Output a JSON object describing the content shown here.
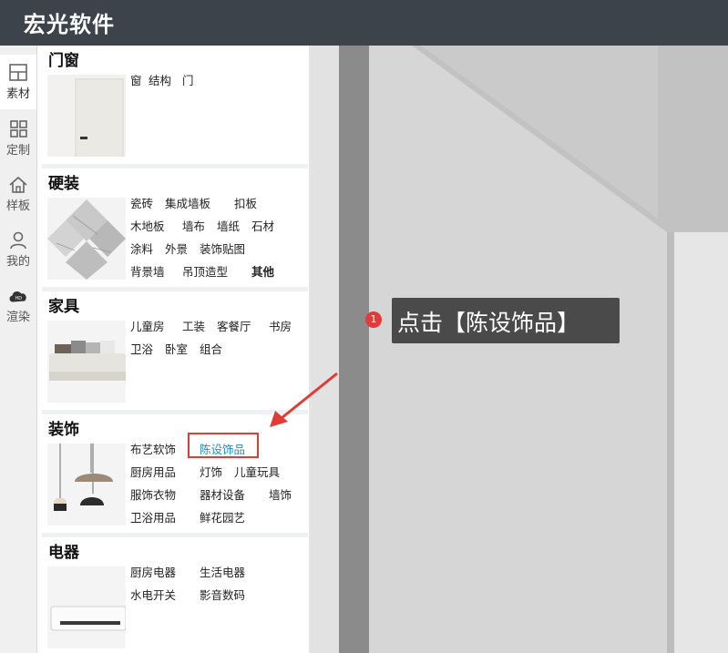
{
  "app": {
    "title": "宏光软件"
  },
  "rail": [
    {
      "label": "素材",
      "icon": "layout-grid-icon"
    },
    {
      "label": "定制",
      "icon": "four-squares-icon"
    },
    {
      "label": "样板",
      "icon": "home-icon"
    },
    {
      "label": "我的",
      "icon": "user-icon"
    },
    {
      "label": "渲染",
      "icon": "cloud-render-icon"
    }
  ],
  "sections": {
    "doors": {
      "title": "门窗",
      "links": [
        "窗",
        "结构",
        "门"
      ]
    },
    "hard": {
      "title": "硬装",
      "links": [
        "瓷砖",
        "集成墙板",
        "扣板",
        "木地板",
        "墙布",
        "墙纸",
        "石材",
        "涂料",
        "外景",
        "装饰贴图",
        "背景墙",
        "吊顶造型",
        "其他"
      ]
    },
    "furniture": {
      "title": "家具",
      "links": [
        "儿童房",
        "工装",
        "客餐厅",
        "书房",
        "卫浴",
        "卧室",
        "组合"
      ]
    },
    "decor": {
      "title": "装饰",
      "links": [
        "布艺软饰",
        "陈设饰品",
        "厨房用品",
        "灯饰",
        "儿童玩具",
        "服饰衣物",
        "器材设备",
        "墙饰",
        "卫浴用品",
        "鲜花园艺"
      ]
    },
    "appliances": {
      "title": "电器",
      "links": [
        "厨房电器",
        "生活电器",
        "水电开关",
        "影音数码"
      ]
    }
  },
  "tooltip": {
    "step": "1",
    "text": "点击【陈设饰品】"
  },
  "colors": {
    "topbar": "#3d434b",
    "highlight": "#e53935",
    "link_active": "#1a8fd6"
  }
}
